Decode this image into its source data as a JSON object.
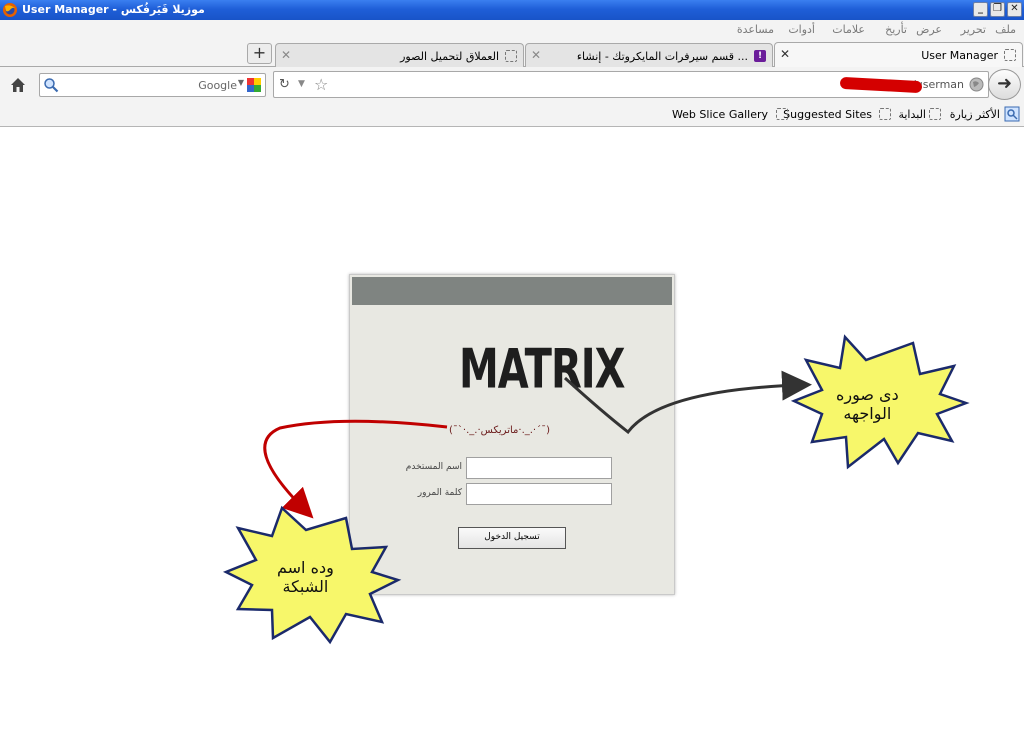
{
  "window": {
    "title": "User Manager - موزيلا فَيَرفُكس"
  },
  "menubar": {
    "items": [
      {
        "label": "ملف"
      },
      {
        "label": "تحرير"
      },
      {
        "label": "عرض"
      },
      {
        "label": "تأريخ"
      },
      {
        "label": "علامات"
      },
      {
        "label": "أدوات"
      },
      {
        "label": "مساعدة"
      }
    ]
  },
  "tabs": [
    {
      "label": "User Manager",
      "active": true
    },
    {
      "label": "قسم سيرفرات المايكروتك - إنشاء ...",
      "active": false
    },
    {
      "label": "العملاق لتحميل الصور",
      "active": false
    }
  ],
  "navbar": {
    "url_text": "/userman",
    "search_engine": "Google"
  },
  "bookmarks": [
    {
      "label": "الأكثر زيارة"
    },
    {
      "label": "البداية"
    },
    {
      "label": "Suggested Sites"
    },
    {
      "label": "Web Slice Gallery"
    }
  ],
  "login": {
    "logo_text": "MATRIX",
    "network_name": "(¯`·._.·ماتريكس·._.·´¯)",
    "username_label": "اسم المستخدم",
    "password_label": "كلمة المرور",
    "submit_label": "تسجيل الدخول"
  },
  "callouts": {
    "face_image": {
      "line1": "دى صوره",
      "line2": "الواجهه"
    },
    "network_name": {
      "line1": "وده اسم",
      "line2": "الشبكة"
    }
  },
  "colors": {
    "titlebar": "#1f5fd8",
    "login_header": "#7f8481",
    "callout_fill": "#f7f76a",
    "callout_stroke": "#1b2a6b",
    "red_arrow": "#c00000",
    "dark_arrow": "#333333",
    "redaction": "#d40000"
  },
  "icons": {
    "home": "home-icon",
    "search": "magnifier-icon",
    "reload": "reload-icon",
    "star": "star-icon",
    "go": "arrow-right-icon"
  }
}
